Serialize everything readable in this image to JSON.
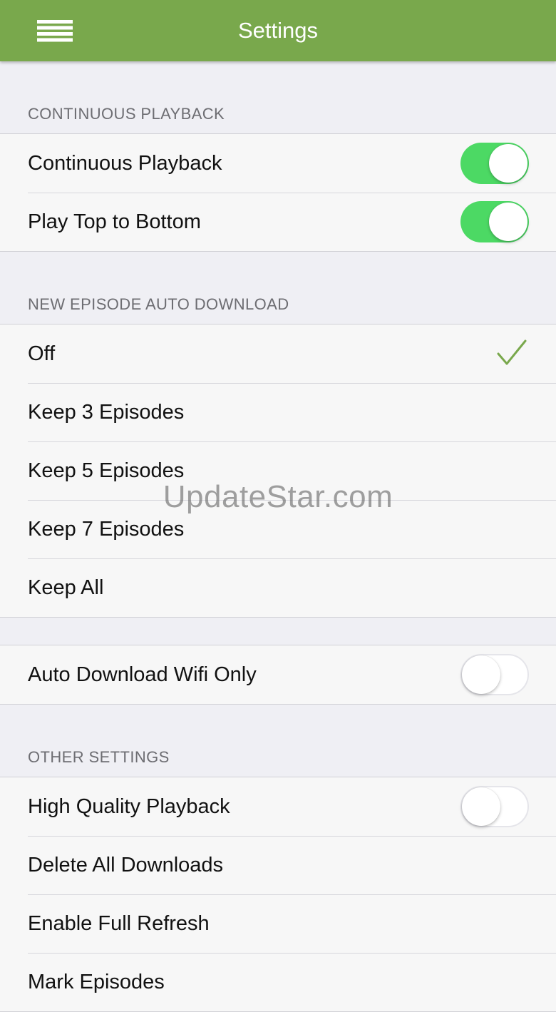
{
  "nav": {
    "title": "Settings",
    "menu_icon": "hamburger-menu-icon",
    "bar_color": "#79a84c"
  },
  "sections": {
    "continuous_playback": {
      "header": "CONTINUOUS PLAYBACK",
      "rows": [
        {
          "label": "Continuous Playback",
          "toggle": true
        },
        {
          "label": "Play Top to Bottom",
          "toggle": true
        }
      ]
    },
    "auto_download": {
      "header": "NEW EPISODE AUTO DOWNLOAD",
      "options": [
        {
          "label": "Off",
          "selected": true
        },
        {
          "label": "Keep 3 Episodes",
          "selected": false
        },
        {
          "label": "Keep 5 Episodes",
          "selected": false
        },
        {
          "label": "Keep 7 Episodes",
          "selected": false
        },
        {
          "label": "Keep All",
          "selected": false
        }
      ],
      "check_icon": "checkmark-icon",
      "check_color": "#79a84c"
    },
    "wifi": {
      "rows": [
        {
          "label": "Auto Download Wifi Only",
          "toggle": false
        }
      ]
    },
    "other_settings": {
      "header": "OTHER SETTINGS",
      "rows": [
        {
          "label": "High Quality Playback",
          "toggle": false
        },
        {
          "label": "Delete All Downloads"
        },
        {
          "label": "Enable Full Refresh"
        },
        {
          "label": "Mark Episodes"
        }
      ]
    }
  },
  "colors": {
    "toggle_on": "#4cd964",
    "background": "#efeff4"
  },
  "watermark": "UpdateStar.com"
}
